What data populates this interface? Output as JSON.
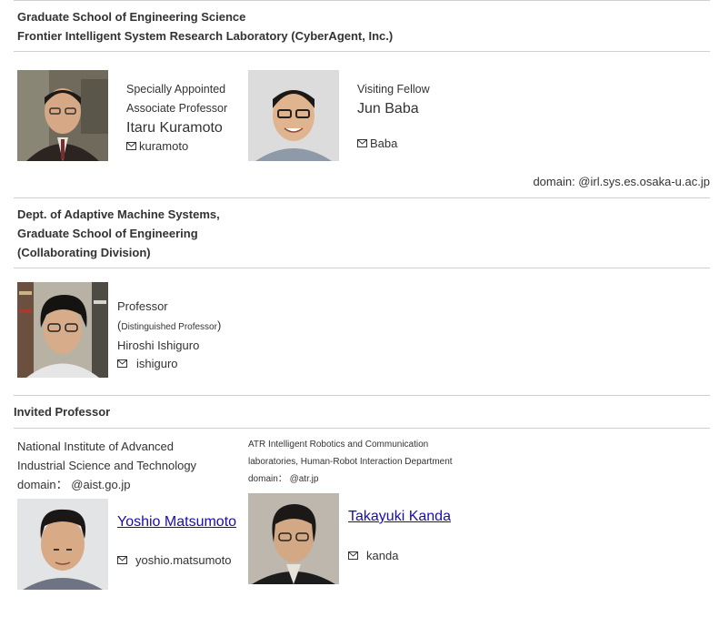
{
  "section1": {
    "heading_line1": "Graduate School of Engineering Science",
    "heading_line2": "Frontier Intelligent System Research Laboratory (CyberAgent, Inc.)",
    "person1": {
      "title_line1": "Specially Appointed",
      "title_line2": "Associate Professor",
      "name": "Itaru Kuramoto",
      "email": "kuramoto"
    },
    "person2": {
      "title": "Visiting Fellow",
      "name": "Jun Baba",
      "email": "Baba"
    },
    "domain": "domain: @irl.sys.es.osaka-u.ac.jp"
  },
  "section2": {
    "heading_line1": "Dept. of Adaptive Machine Systems,",
    "heading_line2": "Graduate School of Engineering",
    "heading_line3": "(Collaborating Division)",
    "person": {
      "title": "Professor",
      "paren_open": "(",
      "subtitle": "Distinguished Professor",
      "paren_close": ")",
      "name": "Hiroshi Ishiguro",
      "email": "ishiguro"
    }
  },
  "section3": {
    "heading": "Invited Professor",
    "left": {
      "org_line1": "National Institute of Advanced",
      "org_line2": "Industrial Science and Technology",
      "domain": "domain： @aist.go.jp",
      "name": "Yoshio Matsumoto",
      "email": "yoshio.matsumoto"
    },
    "right": {
      "org_line1": "ATR Intelligent Robotics and Communication",
      "org_line2": "laboratories, Human-Robot Interaction Department",
      "domain": "domain： @atr.jp",
      "name": "Takayuki Kanda",
      "email": "kanda"
    }
  },
  "icons": {
    "mail": "mail-icon",
    "photo": "person-photo"
  }
}
